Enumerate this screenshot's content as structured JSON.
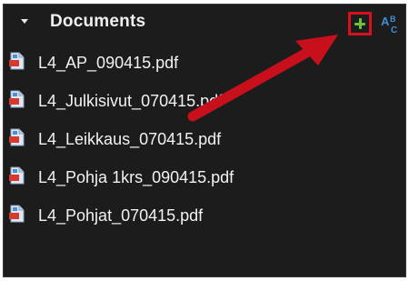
{
  "panel": {
    "title": "Documents",
    "icons": {
      "collapse": "triangle-down-icon",
      "add": "plus-icon",
      "sort": "abc-sort-icon",
      "file": "pdf-file-icon"
    },
    "colors": {
      "background": "#1c1c1c",
      "text": "#f2f2f2",
      "add_icon": "#69c23a",
      "highlight": "#d6101f",
      "sort_icon": "#3d8fd6"
    },
    "files": [
      {
        "name": "L4_AP_090415.pdf"
      },
      {
        "name": "L4_Julkisivut_070415.pdf"
      },
      {
        "name": "L4_Leikkaus_070415.pdf"
      },
      {
        "name": "L4_Pohja 1krs_090415.pdf"
      },
      {
        "name": "L4_Pohjat_070415.pdf"
      }
    ]
  },
  "annotation": {
    "arrow_color": "#d6101f"
  }
}
